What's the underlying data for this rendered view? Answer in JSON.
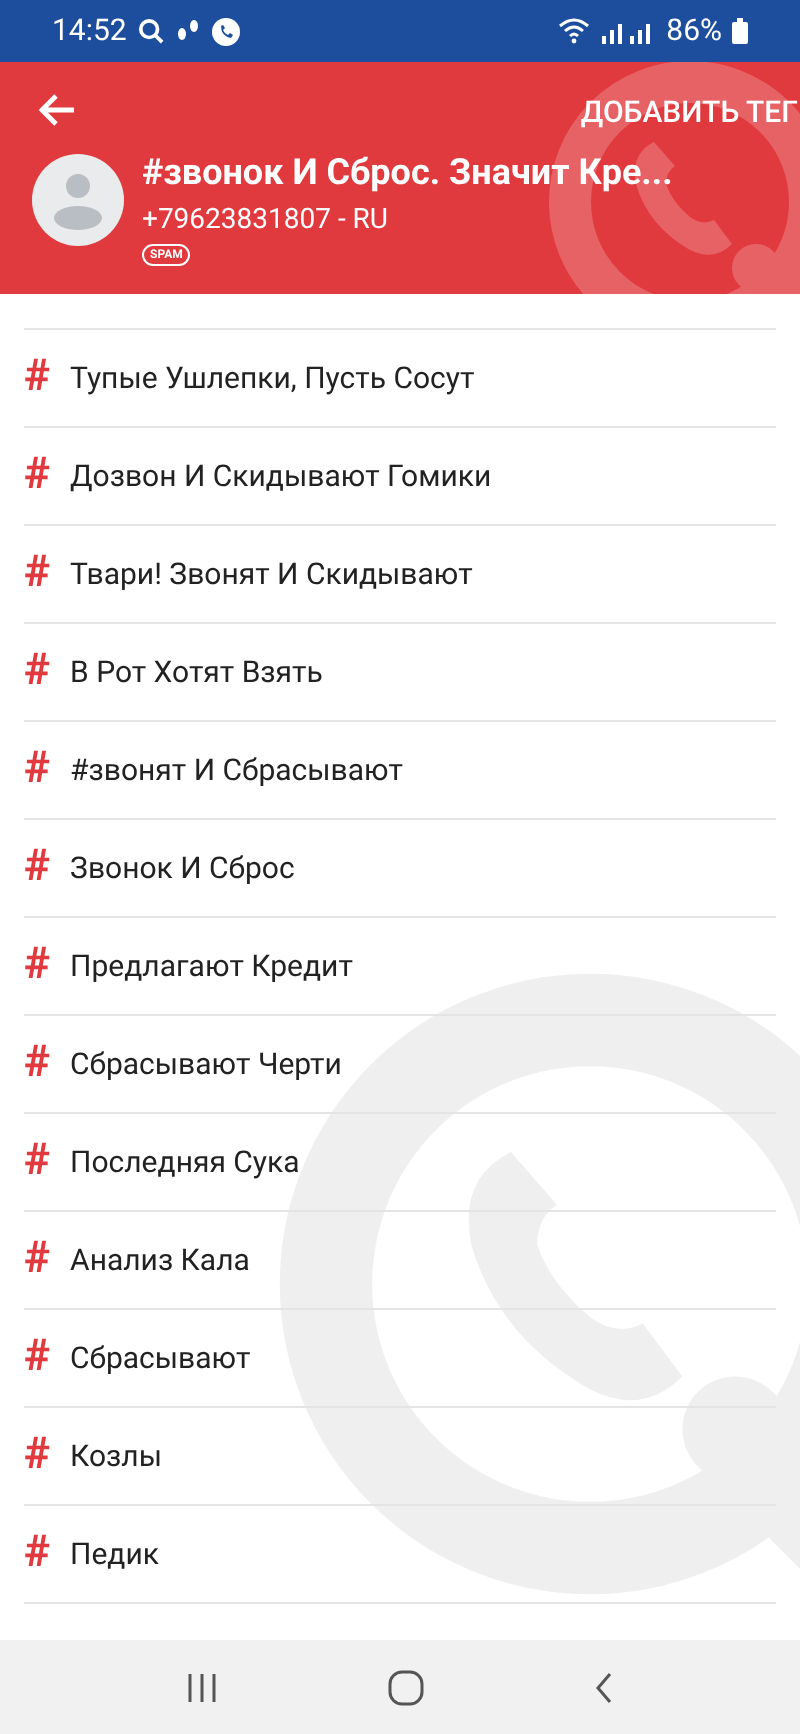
{
  "status_bar": {
    "time": "14:52",
    "battery": "86%"
  },
  "header": {
    "action": "ДОБАВИТЬ ТЕГ",
    "title": "#звонок И Сброс. Значит Кре...",
    "phone": "+79623831807 - RU",
    "badge": "SPAM"
  },
  "tags": [
    {
      "hash": "#",
      "label": "Тупые Ушлепки, Пусть Сосут"
    },
    {
      "hash": "#",
      "label": "Дозвон И Скидывают Гомики"
    },
    {
      "hash": "#",
      "label": "Твари! Звонят И Скидывают"
    },
    {
      "hash": "#",
      "label": "В Рот Хотят Взять"
    },
    {
      "hash": "#",
      "label": "#звонят И Сбрасывают"
    },
    {
      "hash": "#",
      "label": "Звонок И Сброс"
    },
    {
      "hash": "#",
      "label": "Предлагают Кредит"
    },
    {
      "hash": "#",
      "label": "Сбрасывают Черти"
    },
    {
      "hash": "#",
      "label": "Последняя Сука"
    },
    {
      "hash": "#",
      "label": "Анализ Кала"
    },
    {
      "hash": "#",
      "label": "Сбрасывают"
    },
    {
      "hash": "#",
      "label": "Козлы"
    },
    {
      "hash": "#",
      "label": "Педик"
    }
  ]
}
